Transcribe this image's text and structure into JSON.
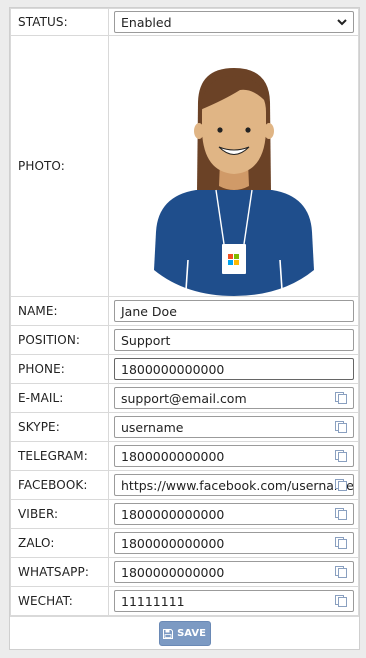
{
  "form": {
    "status": {
      "label": "STATUS:",
      "value": "Enabled"
    },
    "photo": {
      "label": "PHOTO:"
    },
    "name": {
      "label": "NAME:",
      "value": "Jane Doe"
    },
    "position": {
      "label": "POSITION:",
      "value": "Support"
    },
    "phone": {
      "label": "PHONE:",
      "value": "1800000000000"
    },
    "email": {
      "label": "E-MAIL:",
      "value": "support@email.com"
    },
    "skype": {
      "label": "SKYPE:",
      "value": "username"
    },
    "telegram": {
      "label": "TELEGRAM:",
      "value": "1800000000000"
    },
    "facebook": {
      "label": "FACEBOOK:",
      "value": "https://www.facebook.com/username"
    },
    "viber": {
      "label": "VIBER:",
      "value": "1800000000000"
    },
    "zalo": {
      "label": "ZALO:",
      "value": "1800000000000"
    },
    "whatsapp": {
      "label": "WHATSAPP:",
      "value": "1800000000000"
    },
    "wechat": {
      "label": "WECHAT:",
      "value": "11111111"
    }
  },
  "footer": {
    "save_label": "SAVE"
  },
  "colors": {
    "accent": "#7c9ac3",
    "shirt": "#1f4e8c",
    "hair": "#6b4226",
    "skin": "#e0b585"
  }
}
